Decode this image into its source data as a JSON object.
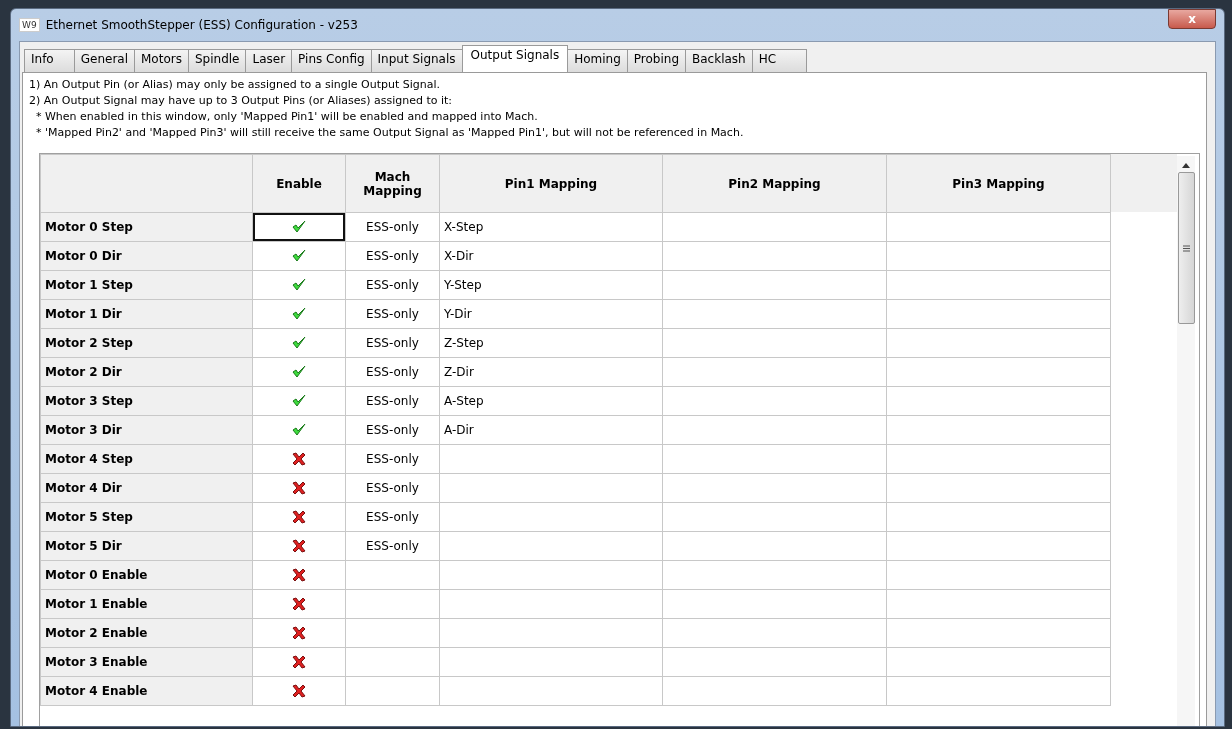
{
  "window": {
    "icon": "W9",
    "title": "Ethernet SmoothStepper (ESS) Configuration - v253",
    "close": "x"
  },
  "tabs": [
    {
      "label": "Info",
      "selected": false
    },
    {
      "label": "General",
      "selected": false
    },
    {
      "label": "Motors",
      "selected": false
    },
    {
      "label": "Spindle",
      "selected": false
    },
    {
      "label": "Laser",
      "selected": false
    },
    {
      "label": "Pins Config",
      "selected": false
    },
    {
      "label": "Input Signals",
      "selected": false
    },
    {
      "label": "Output Signals",
      "selected": true
    },
    {
      "label": "Homing",
      "selected": false
    },
    {
      "label": "Probing",
      "selected": false
    },
    {
      "label": "Backlash",
      "selected": false
    },
    {
      "label": "HC",
      "selected": false
    }
  ],
  "notes": [
    "1) An Output Pin (or Alias) may only be assigned to a single Output Signal.",
    "2) An Output Signal may have up to 3 Output Pins (or Aliases) assigned to it:",
    "  * When enabled in this window, only 'Mapped Pin1' will be enabled and mapped into Mach.",
    "  * 'Mapped Pin2' and 'Mapped Pin3' will still receive the same Output Signal as 'Mapped Pin1', but will not be referenced in Mach."
  ],
  "table": {
    "columns": [
      "Enable",
      "Mach Mapping",
      "Pin1 Mapping",
      "Pin2 Mapping",
      "Pin3 Mapping"
    ],
    "rows": [
      {
        "signal": "Motor 0 Step",
        "enabled": true,
        "focused": true,
        "mach": "ESS-only",
        "pin1": "X-Step"
      },
      {
        "signal": "Motor 0 Dir",
        "enabled": true,
        "focused": false,
        "mach": "ESS-only",
        "pin1": "X-Dir"
      },
      {
        "signal": "Motor 1 Step",
        "enabled": true,
        "focused": false,
        "mach": "ESS-only",
        "pin1": "Y-Step"
      },
      {
        "signal": "Motor 1 Dir",
        "enabled": true,
        "focused": false,
        "mach": "ESS-only",
        "pin1": "Y-Dir"
      },
      {
        "signal": "Motor 2 Step",
        "enabled": true,
        "focused": false,
        "mach": "ESS-only",
        "pin1": "Z-Step"
      },
      {
        "signal": "Motor 2 Dir",
        "enabled": true,
        "focused": false,
        "mach": "ESS-only",
        "pin1": "Z-Dir"
      },
      {
        "signal": "Motor 3 Step",
        "enabled": true,
        "focused": false,
        "mach": "ESS-only",
        "pin1": "A-Step"
      },
      {
        "signal": "Motor 3 Dir",
        "enabled": true,
        "focused": false,
        "mach": "ESS-only",
        "pin1": "A-Dir"
      },
      {
        "signal": "Motor 4 Step",
        "enabled": false,
        "focused": false,
        "mach": "ESS-only"
      },
      {
        "signal": "Motor 4 Dir",
        "enabled": false,
        "focused": false,
        "mach": "ESS-only"
      },
      {
        "signal": "Motor 5 Step",
        "enabled": false,
        "focused": false,
        "mach": "ESS-only"
      },
      {
        "signal": "Motor 5 Dir",
        "enabled": false,
        "focused": false,
        "mach": "ESS-only"
      },
      {
        "signal": "Motor 0 Enable",
        "enabled": false,
        "focused": false
      },
      {
        "signal": "Motor 1 Enable",
        "enabled": false,
        "focused": false
      },
      {
        "signal": "Motor 2 Enable",
        "enabled": false,
        "focused": false
      },
      {
        "signal": "Motor 3 Enable",
        "enabled": false,
        "focused": false
      },
      {
        "signal": "Motor 4 Enable",
        "enabled": false,
        "focused": false
      }
    ]
  }
}
